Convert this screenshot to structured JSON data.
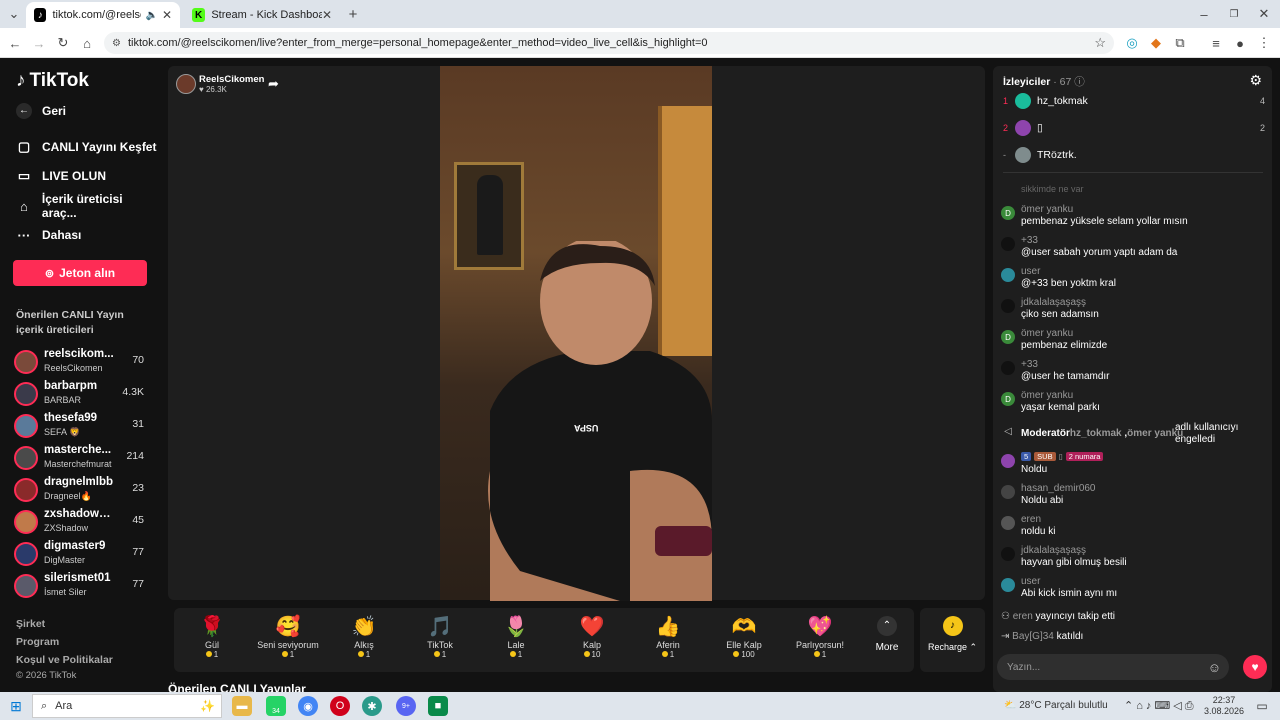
{
  "browser": {
    "tabs": [
      {
        "title": "tiktok.com/@reelscikomen/",
        "icon": "tiktok-icon"
      },
      {
        "title": "Stream - Kick Dashboard",
        "icon": "kick-icon"
      }
    ],
    "url": "tiktok.com/@reelscikomen/live?enter_from_merge=personal_homepage&enter_method=video_live_cell&is_highlight=0"
  },
  "sidebar": {
    "logo": "TikTok",
    "back": "Geri",
    "nav": [
      {
        "label": "CANLI Yayını Keşfet",
        "icon": "live-tv-icon"
      },
      {
        "label": "LIVE OLUN",
        "icon": "camera-icon"
      },
      {
        "label": "İçerik üreticisi araç...",
        "icon": "home-tools-icon"
      },
      {
        "label": "Dahası",
        "icon": "more-icon"
      }
    ],
    "coins_button": "Jeton alın",
    "section_title": "Önerilen CANLI Yayın içerik üreticileri",
    "creators": [
      {
        "user": "reelscikom...",
        "name": "ReelsCikomen",
        "count": "70"
      },
      {
        "user": "barbarpm",
        "name": "BARBAR",
        "count": "4.3K"
      },
      {
        "user": "thesefa99",
        "name": "SEFA 🦁",
        "count": "31"
      },
      {
        "user": "masterche...",
        "name": "Masterchefmurat",
        "count": "214"
      },
      {
        "user": "dragnelmlbb",
        "name": "Dragneel🔥",
        "count": "23"
      },
      {
        "user": "zxshadow_...",
        "name": "ZXShadow",
        "count": "45"
      },
      {
        "user": "digmaster9",
        "name": "DigMaster",
        "count": "77"
      },
      {
        "user": "silerismet01",
        "name": "İsmet Siler",
        "count": "77"
      }
    ],
    "footer": [
      "Şirket",
      "Program",
      "Koşul ve Politikalar",
      "© 2026 TikTok"
    ]
  },
  "stream": {
    "streamer_name": "ReelsCikomen",
    "likes": "26.3K",
    "shirt_text": "USPA",
    "suggested_heading": "Önerilen CANLI Yayınlar"
  },
  "gifts": [
    {
      "name": "Gül",
      "price": "1",
      "icon": "🌹"
    },
    {
      "name": "Seni seviyorum",
      "price": "1",
      "icon": "🥰"
    },
    {
      "name": "Alkış",
      "price": "1",
      "icon": "👏"
    },
    {
      "name": "TikTok",
      "price": "1",
      "icon": "🎵"
    },
    {
      "name": "Lale",
      "price": "1",
      "icon": "🌷"
    },
    {
      "name": "Kalp",
      "price": "10",
      "icon": "❤️"
    },
    {
      "name": "Aferin",
      "price": "1",
      "icon": "👍"
    },
    {
      "name": "Elle Kalp",
      "price": "100",
      "icon": "🫶"
    },
    {
      "name": "Parlıyorsun!",
      "price": "1",
      "icon": "💖"
    }
  ],
  "gift_more": "More",
  "recharge": "Recharge",
  "chat": {
    "viewers_title": "İzleyiciler",
    "viewers_count": "· 67",
    "top_viewers": [
      {
        "rank": "1",
        "name": "hz_tokmak",
        "count": "4",
        "color": "#1abc9c"
      },
      {
        "rank": "2",
        "name": "▯",
        "count": "2",
        "color": "#8e44ad"
      },
      {
        "rank": "-",
        "name": "TRöztrk.",
        "count": "",
        "color": "#7f8c8d"
      }
    ],
    "truncated_line": "sikkimde ne var",
    "messages": [
      {
        "user": "ömer yanku",
        "text": "pembenaz yüksele selam yollar mısın",
        "avatar": "D",
        "color": "#3a8a3a"
      },
      {
        "user": "+33",
        "text": "@user sabah yorum yaptı adam da",
        "avatar": "",
        "color": "#111"
      },
      {
        "user": "user",
        "text": "@+33 ben yoktm kral",
        "avatar": "",
        "color": "#2a8a9a"
      },
      {
        "user": "jdkalalaşaşaşş",
        "text": "çiko sen adamsın",
        "avatar": "",
        "color": "#111"
      },
      {
        "user": "ömer yanku",
        "text": "pembenaz elimizde",
        "avatar": "D",
        "color": "#3a8a3a"
      },
      {
        "user": "+33",
        "text": "@user he tamamdır",
        "avatar": "",
        "color": "#111"
      },
      {
        "user": "ömer yanku",
        "text": "yaşar kemal parkı",
        "avatar": "D",
        "color": "#3a8a3a"
      }
    ],
    "moderation": {
      "label": "Moderatör",
      "mod": "hz_tokmak",
      "target": "ömer yanku",
      "suffix": "adlı kullanıcıyı engelledi"
    },
    "badges": {
      "level": "5",
      "sub": "SUB",
      "rank": "2 numara"
    },
    "badge_msg": "Noldu",
    "messages2": [
      {
        "user": "hasan_demir060",
        "text": "Noldu abi",
        "color": "#444"
      },
      {
        "user": "eren",
        "text": "noldu ki",
        "color": "#555"
      },
      {
        "user": "jdkalalaşaşaşş",
        "text": "hayvan gibi olmuş besili",
        "color": "#111"
      },
      {
        "user": "user",
        "text": "Abi kick ismin aynı mı",
        "color": "#2a8a9a"
      }
    ],
    "follow_event": {
      "user": "eren",
      "text": "yayıncıyı takip etti"
    },
    "join_event": {
      "user": "Bay[G]34",
      "text": "katıldı"
    },
    "input_placeholder": "Yazın..."
  },
  "taskbar": {
    "search": "Ara",
    "weather": "28°C  Parçalı bulutlu",
    "time": "22:37",
    "date": "3.08.2026",
    "whatsapp_badge": "34",
    "notif_badge": "9+"
  }
}
